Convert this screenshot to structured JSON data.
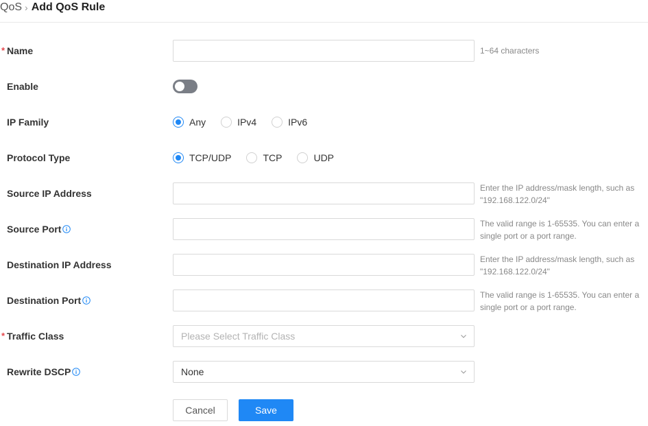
{
  "breadcrumb": {
    "parent": "QoS",
    "separator": "›",
    "current": "Add QoS Rule"
  },
  "form": {
    "required_mark": "*",
    "name": {
      "label": "Name",
      "value": "",
      "hint": "1~64 characters"
    },
    "enable": {
      "label": "Enable",
      "on": false
    },
    "ip_family": {
      "label": "IP Family",
      "options": [
        "Any",
        "IPv4",
        "IPv6"
      ],
      "selected": "Any"
    },
    "protocol_type": {
      "label": "Protocol Type",
      "options": [
        "TCP/UDP",
        "TCP",
        "UDP"
      ],
      "selected": "TCP/UDP"
    },
    "source_ip": {
      "label": "Source IP Address",
      "value": "",
      "hint_line1": "Enter the IP address/mask length, such as",
      "hint_line2": "\"192.168.122.0/24\""
    },
    "source_port": {
      "label": "Source Port",
      "value": "",
      "hint_line1": "The valid range is 1-65535. You can enter a",
      "hint_line2": "single port or a port range."
    },
    "dest_ip": {
      "label": "Destination IP Address",
      "value": "",
      "hint_line1": "Enter the IP address/mask length, such as",
      "hint_line2": "\"192.168.122.0/24\""
    },
    "dest_port": {
      "label": "Destination Port",
      "value": "",
      "hint_line1": "The valid range is 1-65535. You can enter a",
      "hint_line2": "single port or a port range."
    },
    "traffic_class": {
      "label": "Traffic Class",
      "placeholder": "Please Select Traffic Class"
    },
    "rewrite_dscp": {
      "label": "Rewrite DSCP",
      "value": "None"
    }
  },
  "buttons": {
    "cancel": "Cancel",
    "save": "Save"
  },
  "colors": {
    "accent": "#1f88f5",
    "required": "#e5484d",
    "toggle_off": "#7a7e86"
  }
}
